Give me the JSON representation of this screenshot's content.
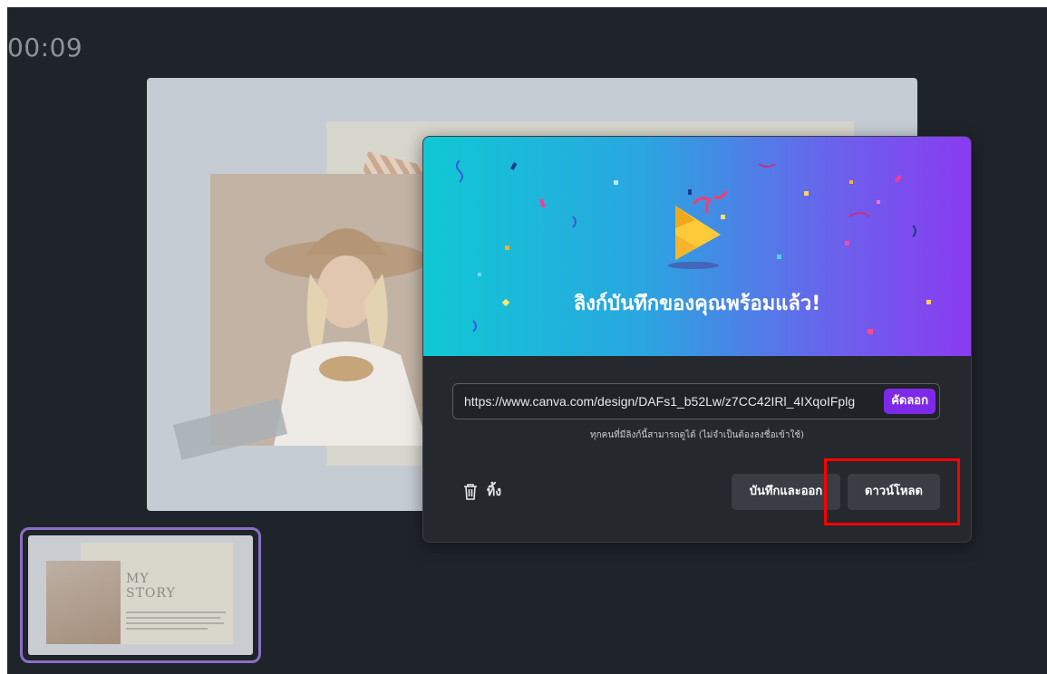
{
  "recording": {
    "timer": "00:09"
  },
  "thumbnail": {
    "title_line1": "MY",
    "title_line2": "STORY"
  },
  "share_dialog": {
    "title": "ลิงก์บันทึกของคุณพร้อมแล้ว!",
    "link_url": "https://www.canva.com/design/DAFs1_b52Lw/z7CC42IRl_4IXqoIFplg",
    "copy_label": "คัดลอก",
    "note": "ทุกคนที่มีลิงก์นี้สามารถดูได้ (ไม่จำเป็นต้องลงชื่อเข้าใช้)",
    "delete_label": "ทิ้ง",
    "save_exit_label": "บันทึกและออก",
    "download_label": "ดาวน์โหลด"
  },
  "colors": {
    "background": "#1f242b",
    "accent": "#7d2ae8",
    "highlight": "#ff0000",
    "thumbnail_border": "#8b6fc3"
  },
  "icons": {
    "trash": "trash-icon",
    "party": "party-popper-icon"
  }
}
